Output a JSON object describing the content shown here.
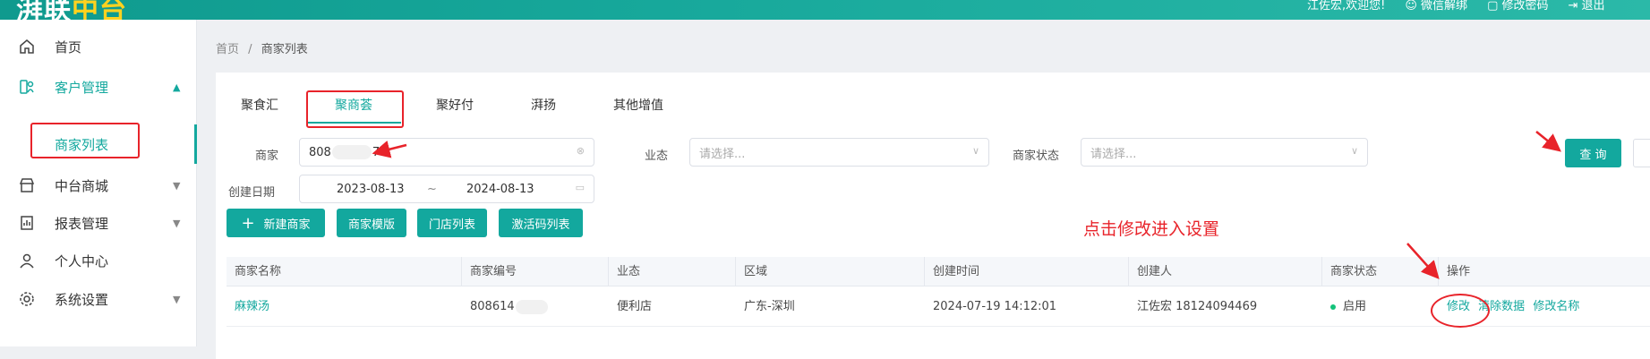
{
  "app": {
    "logo_text": "湃联",
    "logo_accent": "中台"
  },
  "topbar": {
    "welcome": "江佐宏,欢迎您!",
    "wechat_unbind": "微信解绑",
    "change_password": "修改密码",
    "logout": "退出"
  },
  "sidebar": {
    "items": [
      {
        "label": "首页",
        "icon": "home-icon"
      },
      {
        "label": "客户管理",
        "icon": "customer-icon"
      },
      {
        "label": "中台商城",
        "icon": "store-icon"
      },
      {
        "label": "报表管理",
        "icon": "report-icon"
      },
      {
        "label": "个人中心",
        "icon": "user-icon"
      },
      {
        "label": "系统设置",
        "icon": "gear-icon"
      }
    ],
    "sub_item": "商家列表"
  },
  "breadcrumb": {
    "home": "首页",
    "separator": "/",
    "current": "商家列表"
  },
  "tabs": [
    {
      "label": "聚食汇"
    },
    {
      "label": "聚商荟"
    },
    {
      "label": "聚好付"
    },
    {
      "label": "湃扬"
    },
    {
      "label": "其他增值"
    }
  ],
  "filters": {
    "merchant_label": "商家",
    "merchant_value_start": "808",
    "merchant_value_end": "74",
    "industry_label": "业态",
    "industry_placeholder": "请选择...",
    "status_label": "商家状态",
    "status_placeholder": "请选择...",
    "date_label": "创建日期",
    "date_start": "2023-08-13",
    "date_sep": "~",
    "date_end": "2024-08-13"
  },
  "buttons": {
    "query": "查 询",
    "new_merchant": "新建商家",
    "merchant_template": "商家模版",
    "store_list": "门店列表",
    "activation_codes": "激活码列表"
  },
  "table": {
    "headers": [
      "商家名称",
      "商家编号",
      "业态",
      "区域",
      "创建时间",
      "创建人",
      "商家状态",
      "操作"
    ],
    "rows": [
      {
        "name": "麻辣汤",
        "code": "808614",
        "industry": "便利店",
        "region": "广东-深圳",
        "created_at": "2024-07-19 14:12:01",
        "creator": "江佐宏 18124094469",
        "status": "启用",
        "actions": [
          "修改",
          "清除数据",
          "修改名称"
        ]
      }
    ]
  },
  "annotation": {
    "text": "点击修改进入设置"
  },
  "colors": {
    "accent": "#13a89e",
    "annotation": "#e8232a",
    "status_on": "#13c27a"
  }
}
